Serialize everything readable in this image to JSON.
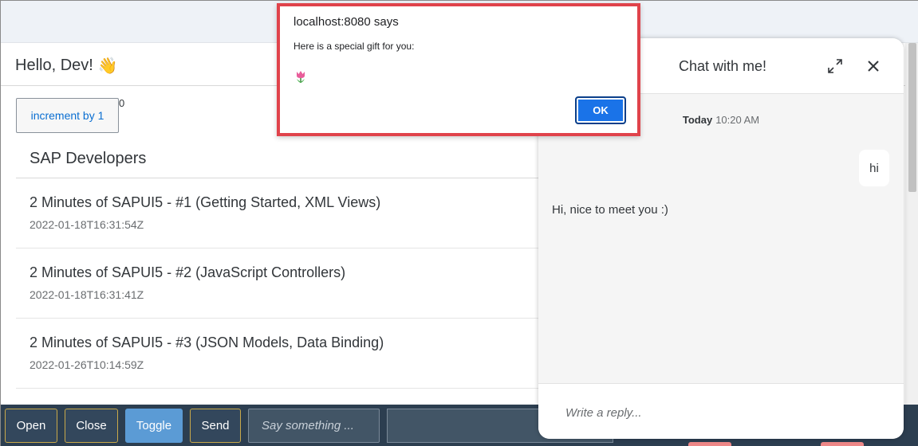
{
  "header": {
    "greeting": "Hello, Dev!",
    "wave_emoji": "👋"
  },
  "increment": {
    "label": "increment by 1",
    "count": "0"
  },
  "list": {
    "title": "SAP Developers",
    "items": [
      {
        "title": "2 Minutes of SAPUI5 - #1 (Getting Started, XML Views)",
        "date": "2022-01-18T16:31:54Z"
      },
      {
        "title": "2 Minutes of SAPUI5 - #2 (JavaScript Controllers)",
        "date": "2022-01-18T16:31:41Z"
      },
      {
        "title": "2 Minutes of SAPUI5 - #3 (JSON Models, Data Binding)",
        "date": "2022-01-26T10:14:59Z"
      }
    ]
  },
  "toolbar": {
    "open_label": "Open",
    "close_label": "Close",
    "toggle_label": "Toggle",
    "send_label": "Send",
    "input_placeholder": "Say something ..."
  },
  "chat": {
    "title": "Chat with me!",
    "day": "Today",
    "time": "10:20 AM",
    "messages": [
      {
        "from": "user",
        "text": "hi"
      },
      {
        "from": "bot",
        "text": "Hi, nice to meet you :)"
      }
    ],
    "reply_placeholder": "Write a reply...",
    "icons": {
      "expand": "expand-icon",
      "close": "close-icon"
    }
  },
  "alert": {
    "origin": "localhost:8080 says",
    "message": "Here is a special gift for you:",
    "emoji": "tulip",
    "ok_label": "OK"
  },
  "colors": {
    "toolbar_bg": "#2c3e50",
    "toggle_bg": "#5b9bd5",
    "alert_highlight": "#e0434b",
    "ok_button": "#1a73e8"
  }
}
